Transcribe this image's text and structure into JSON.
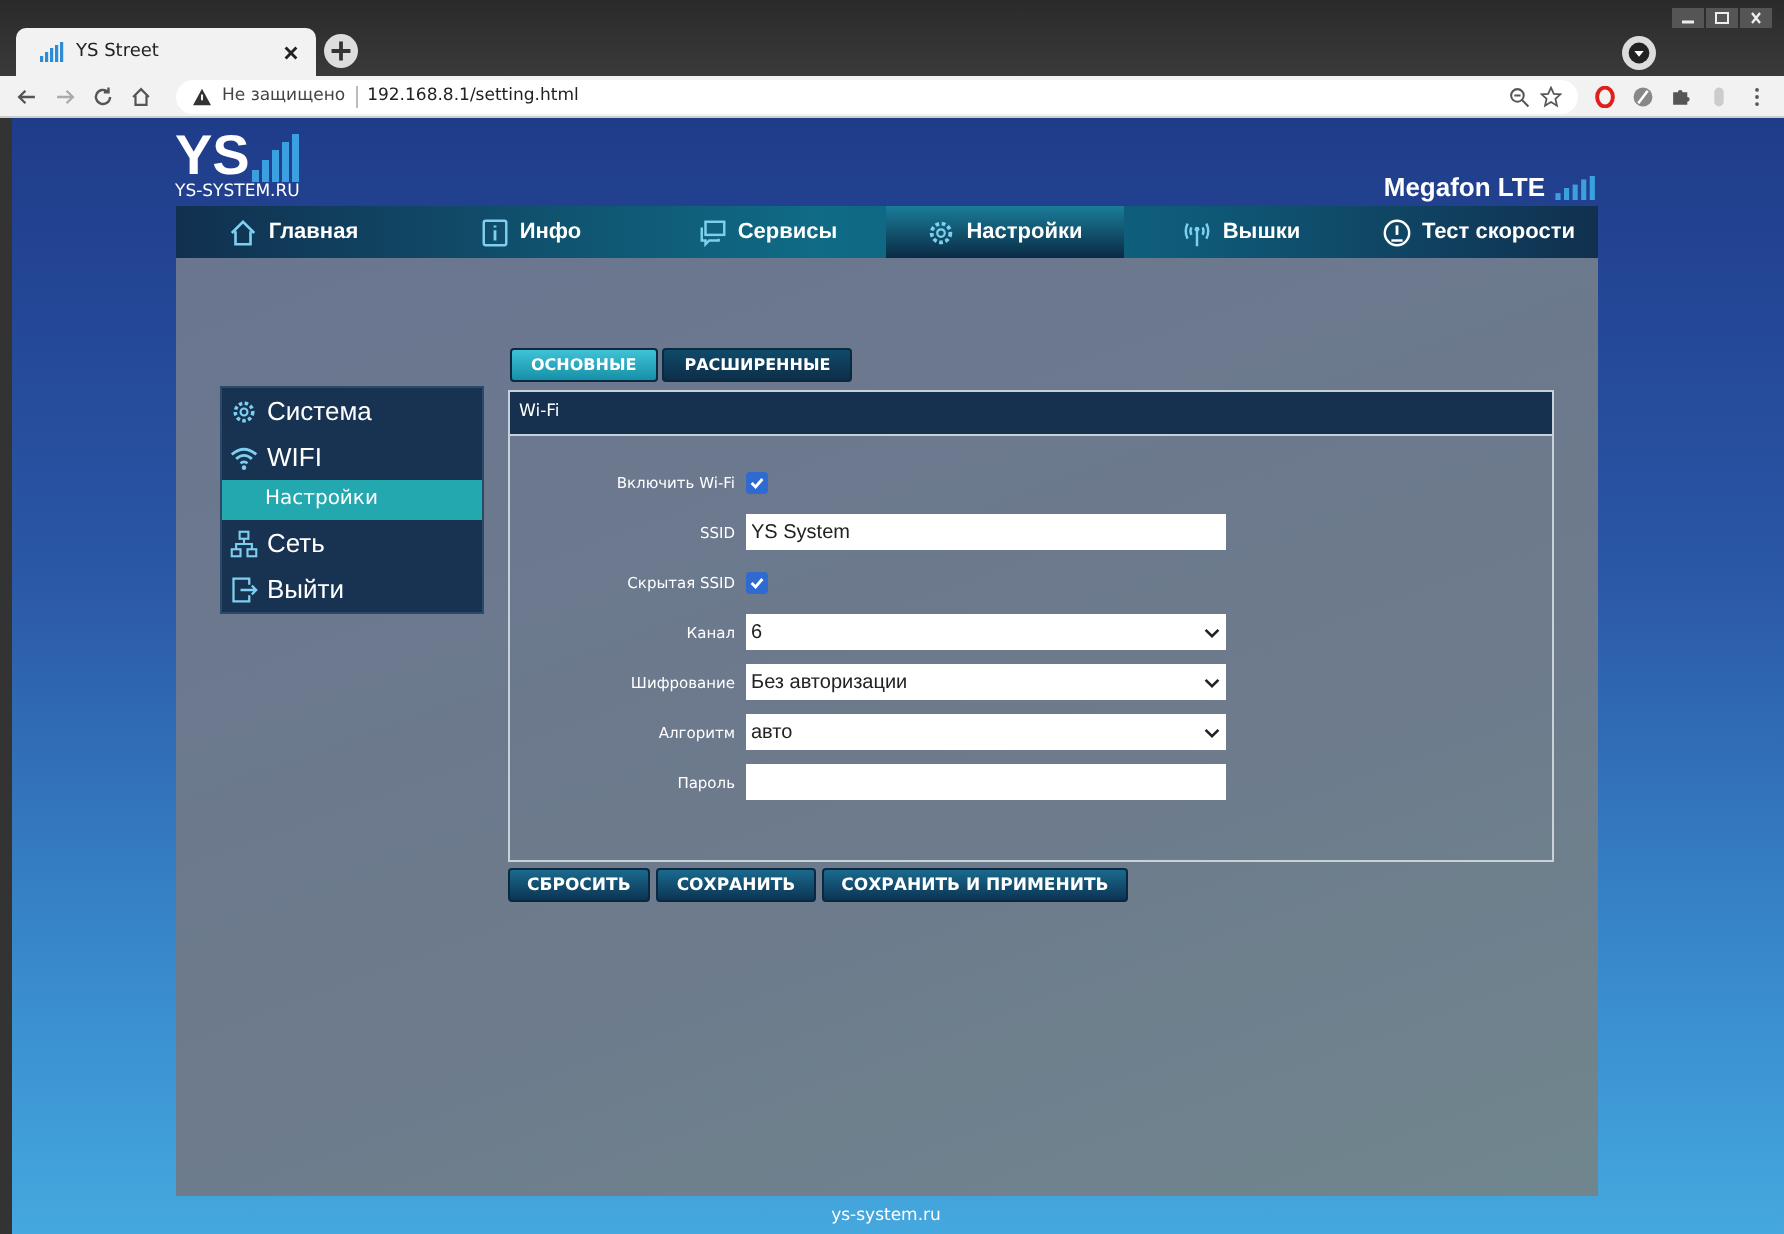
{
  "browser": {
    "tab_title": "YS Street",
    "security": "Не защищено",
    "url": "192.168.8.1/setting.html"
  },
  "header": {
    "logo": "YS",
    "logo_sub": "YS-SYSTEM.RU",
    "operator": "Megafon LTE"
  },
  "nav": [
    {
      "label": "Главная",
      "selected": false
    },
    {
      "label": "Инфо",
      "selected": false
    },
    {
      "label": "Сервисы",
      "selected": false
    },
    {
      "label": "Настройки",
      "selected": true
    },
    {
      "label": "Вышки",
      "selected": false
    },
    {
      "label": "Тест скорости",
      "selected": false
    }
  ],
  "sidebar": {
    "items": [
      {
        "label": "Система",
        "selected": false
      },
      {
        "label": "WIFI",
        "selected": false,
        "children": [
          {
            "label": "Настройки",
            "selected": true
          }
        ]
      },
      {
        "label": "Сеть",
        "selected": false
      },
      {
        "label": "Выйти",
        "selected": false
      }
    ]
  },
  "tabs": [
    {
      "label": "ОСНОВНЫЕ",
      "selected": true
    },
    {
      "label": "РАСШИРЕННЫЕ",
      "selected": false
    }
  ],
  "panel": {
    "title": "Wi-Fi",
    "fields": [
      {
        "kind": "checkbox",
        "label": "Включить Wi-Fi",
        "checked": true
      },
      {
        "kind": "text",
        "label": "SSID",
        "value": "YS System"
      },
      {
        "kind": "checkbox",
        "label": "Скрытая SSID",
        "checked": true
      },
      {
        "kind": "select",
        "label": "Канал",
        "value": "6"
      },
      {
        "kind": "select",
        "label": "Шифрование",
        "value": "Без авторизации"
      },
      {
        "kind": "select",
        "label": "Алгоритм",
        "value": "авто"
      },
      {
        "kind": "text",
        "label": "Пароль"
      }
    ]
  },
  "buttons": [
    "СБРОСИТЬ",
    "СОХРАНИТЬ",
    "СОХРАНИТЬ И ПРИМЕНИТЬ"
  ],
  "footer": "ys-system.ru"
}
